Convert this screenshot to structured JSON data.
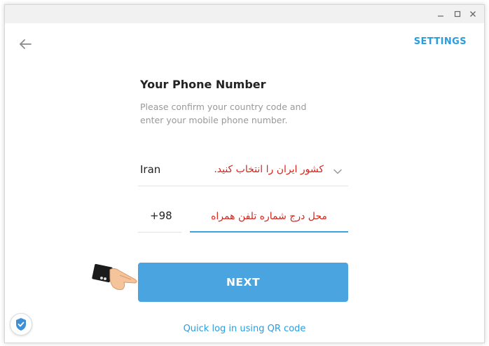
{
  "window": {
    "minimize_icon": "minimize-icon",
    "maximize_icon": "maximize-icon",
    "close_icon": "close-icon"
  },
  "header": {
    "back_icon": "arrow-left-icon",
    "settings_label": "SETTINGS"
  },
  "login": {
    "title": "Your Phone Number",
    "description": "Please confirm your country code and enter your mobile phone number.",
    "country": {
      "value": "Iran",
      "annotation": "کشور ایران را انتخاب کنید.",
      "icon": "chevron-down-icon"
    },
    "country_code": "+98",
    "phone_annotation": "محل درج شماره تلفن همراه",
    "next_label": "NEXT",
    "qr_link": "Quick log in using QR code"
  },
  "colors": {
    "accent": "#4aa4e0",
    "link": "#2a9de1",
    "annotation": "#d9241c"
  }
}
